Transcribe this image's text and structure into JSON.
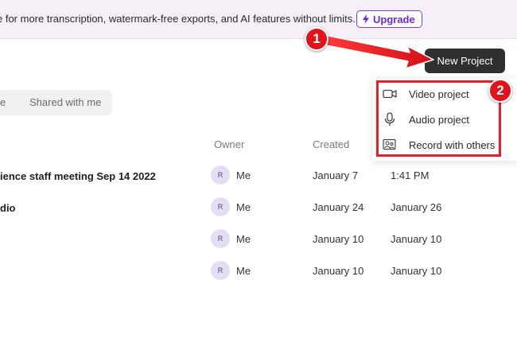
{
  "banner": {
    "text": "e for more transcription, watermark-free exports, and AI features without limits.",
    "upgrade_label": "Upgrade"
  },
  "header": {
    "new_project_label": "New Project"
  },
  "tabs": {
    "cut_label": "e",
    "shared_label": "Shared with me"
  },
  "table": {
    "columns": {
      "owner": "Owner",
      "created": "Created"
    },
    "rows": [
      {
        "name": "ience staff meeting Sep 14 2022",
        "avatar": "R",
        "owner": "Me",
        "created": "January 7",
        "modified": "1:41 PM"
      },
      {
        "name": "dio",
        "avatar": "R",
        "owner": "Me",
        "created": "January 24",
        "modified": "January 26"
      },
      {
        "name": "",
        "avatar": "R",
        "owner": "Me",
        "created": "January 10",
        "modified": "January 10"
      },
      {
        "name": "",
        "avatar": "R",
        "owner": "Me",
        "created": "January 10",
        "modified": "January 10"
      }
    ]
  },
  "dropdown": {
    "items": [
      {
        "label": "Video project",
        "icon": "video-camera-icon"
      },
      {
        "label": "Audio project",
        "icon": "microphone-icon"
      },
      {
        "label": "Record with others",
        "icon": "people-record-icon"
      }
    ]
  },
  "annotations": {
    "step1": "1",
    "step2": "2",
    "highlight_color": "#ee1c24"
  },
  "colors": {
    "accent": "#7c3aed",
    "banner_bg": "#f7eff8",
    "primary_button": "#2f2f2f",
    "annotation_red": "#e3131b"
  }
}
